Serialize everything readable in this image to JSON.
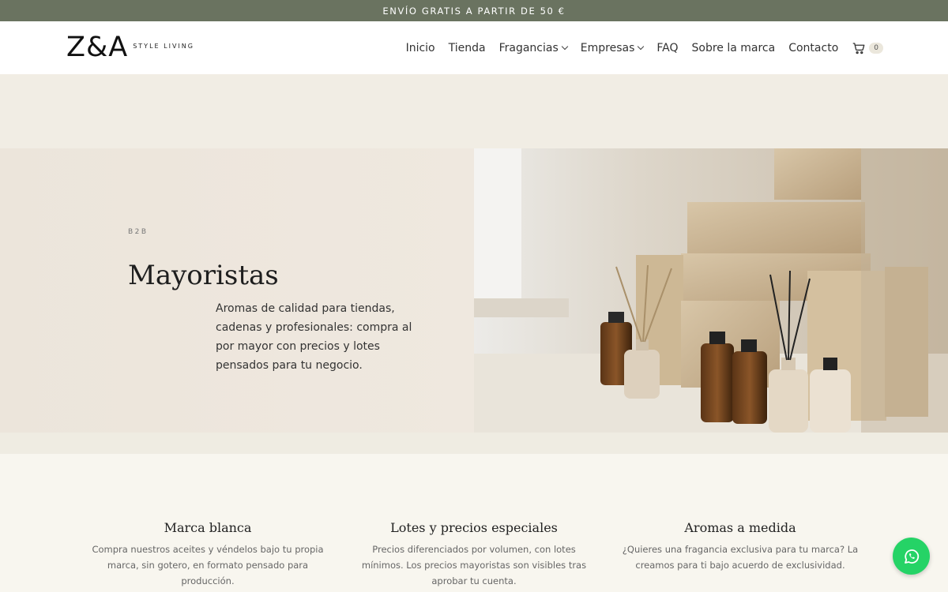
{
  "topbar": {
    "text": "ENVÍO GRATIS A PARTIR DE 50 €"
  },
  "header": {
    "logo_mark": "Z&A",
    "logo_sub": "STYLE LIVING",
    "nav": [
      {
        "label": "Inicio",
        "dropdown": false
      },
      {
        "label": "Tienda",
        "dropdown": false
      },
      {
        "label": "Fragancias",
        "dropdown": true
      },
      {
        "label": "Empresas",
        "dropdown": true
      },
      {
        "label": "FAQ",
        "dropdown": false
      },
      {
        "label": "Sobre la marca",
        "dropdown": false
      },
      {
        "label": "Contacto",
        "dropdown": false
      }
    ],
    "cart_count": "0",
    "cart_icon": "shopping-cart-icon"
  },
  "hero": {
    "eyebrow": "B2B",
    "title": "Mayoristas",
    "description": "Aromas de calidad para tiendas, cadenas y profesionales: compra al por mayor con precios y lotes pensados para tu negocio."
  },
  "features": [
    {
      "title": "Marca blanca",
      "text": "Compra nuestros aceites y véndelos bajo tu propia marca, sin gotero, en formato pensado para producción."
    },
    {
      "title": "Lotes y precios especiales",
      "text": "Precios diferenciados por volumen, con lotes mínimos. Los precios mayoristas son visibles tras aprobar tu cuenta."
    },
    {
      "title": "Aromas a medida",
      "text": "¿Quieres una fragancia exclusiva para tu marca? La creamos para ti bajo acuerdo de exclusividad."
    }
  ],
  "colors": {
    "topbar": "#6a7360",
    "whatsapp": "#25d366",
    "background": "#f7f5ee"
  },
  "whatsapp_icon": "whatsapp-icon"
}
